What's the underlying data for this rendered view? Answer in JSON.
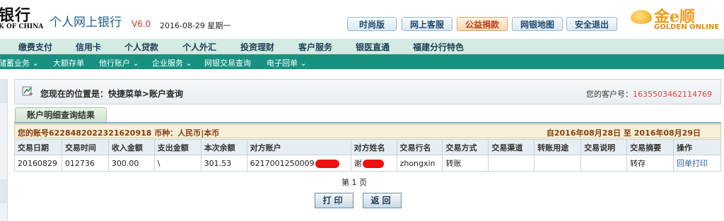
{
  "header": {
    "bank_name": "银行",
    "bank_name_en": "K OF CHINA",
    "site_title": "个人网上银行",
    "version": "V6.0",
    "date": "2016-08-29 星期一",
    "toolbar": [
      "时尚版",
      "网上客服",
      "公益捐款",
      "网银地图",
      "安全退出"
    ],
    "golden_title": "金e顺",
    "golden_en": "GOLDEN ONLINE"
  },
  "nav1": [
    "缴费支付",
    "信用卡",
    "个人贷款",
    "个人外汇",
    "投资理财",
    "客户服务",
    "银医直通",
    "福建分行特色"
  ],
  "nav2": [
    "储蓄业务 ⌄",
    "大额存单",
    "他行账户 ⌄",
    "企业服务 ⌄",
    "网银交易查询",
    "电子回单 ⌄"
  ],
  "location": {
    "text": "您现在的位置是：快捷菜单>账户查询",
    "customer_label": "您的客户号：",
    "customer_no": "1635503462114769"
  },
  "tab_label": "账户明细查询结果",
  "account_info": {
    "left": "您的账号6228482022321620918 币种：人民币|本币",
    "right": "自2016年08月28日  至  2016年08月29日"
  },
  "table": {
    "headers": [
      "交易日期",
      "交易时间",
      "收入金额",
      "支出金额",
      "本次余额",
      "对方账户",
      "对方姓名",
      "交易行名",
      "交易方式",
      "交易渠道",
      "转账用途",
      "交易说明",
      "交易摘要",
      "操作"
    ],
    "row": {
      "date": "20160829",
      "time": "012736",
      "income": "300.00",
      "expense": "\\",
      "balance": "301.53",
      "account": "6217001250009",
      "name": "谢",
      "bank": "zhongxin",
      "method": "转账",
      "channel": "",
      "purpose": "",
      "desc": "",
      "summary": "转存",
      "action": "回单打印"
    }
  },
  "pager": "第 1 页",
  "buttons": {
    "print": "打印",
    "back": "返回"
  }
}
